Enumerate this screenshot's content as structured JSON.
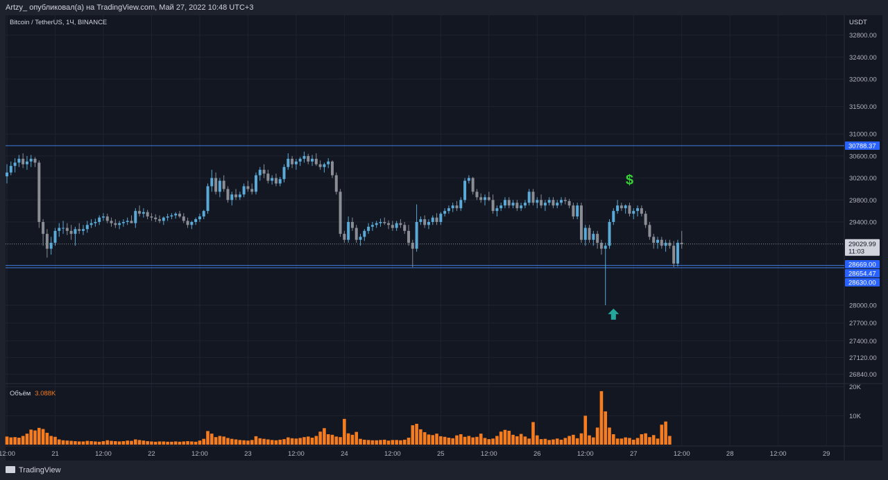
{
  "header": {
    "publish_text": "Artzy_ опубликовал(а) на TradingView.com, Май 27, 2022 10:48 UTC+3"
  },
  "chart_title": "Bitcoin / TetherUS, 1Ч, BINANCE",
  "footer": {
    "brand": "TradingView"
  },
  "colors": {
    "bg": "#131722",
    "up": "#5aa9d6",
    "down": "#8a8d94",
    "volume": "#f57c1f",
    "line": "#3f7fe0",
    "arrow": "#26a69a",
    "dollar": "#35d135"
  },
  "chart_data": {
    "type": "candlestick",
    "symbol": "BTCUSDT",
    "price_axis": {
      "currency": "USDT",
      "ticks": [
        32800,
        32400,
        32000,
        31500,
        31000,
        30600,
        30200,
        29800,
        29400,
        28000,
        27700,
        27400,
        27120,
        26840
      ],
      "tick_labels": [
        "32800.00",
        "32400.00",
        "32000.00",
        "31500.00",
        "31000.00",
        "30600.00",
        "30200.00",
        "29800.00",
        "29400.00",
        "28000.00",
        "27700.00",
        "27400.00",
        "27120.00",
        "26840.00"
      ]
    },
    "time_axis": {
      "ticks": [
        0,
        12,
        24,
        36,
        48,
        60,
        72,
        84,
        96,
        108,
        120,
        132,
        144,
        156,
        168,
        180,
        192,
        204
      ],
      "tick_labels": [
        "12:00",
        "21",
        "12:00",
        "22",
        "12:00",
        "23",
        "12:00",
        "24",
        "12:00",
        "25",
        "12:00",
        "26",
        "12:00",
        "27",
        "12:00",
        "28",
        "12:00",
        "29"
      ]
    },
    "horizontal_lines": [
      {
        "price": 30788.37,
        "label": "30788.37"
      },
      {
        "price": 28669.0,
        "label": "28669.00"
      },
      {
        "price": 28654.47,
        "label": "28654.47"
      },
      {
        "price": 28630.0,
        "label": "28630.00"
      }
    ],
    "last_price": {
      "value": 29029.99,
      "label": "29029.99",
      "countdown": "11:03"
    },
    "annotations": {
      "dollar_text": "$",
      "dollar_at": [
        155,
        30080
      ],
      "arrow_up_at": [
        151,
        27850
      ]
    },
    "candles": [
      [
        30230,
        30450,
        30100,
        30300
      ],
      [
        30300,
        30500,
        30250,
        30420
      ],
      [
        30420,
        30560,
        30300,
        30480
      ],
      [
        30480,
        30620,
        30400,
        30550
      ],
      [
        30550,
        30650,
        30380,
        30450
      ],
      [
        30450,
        30600,
        30350,
        30500
      ],
      [
        30500,
        30620,
        30400,
        30550
      ],
      [
        30550,
        30580,
        30400,
        30480
      ],
      [
        30480,
        30520,
        29300,
        29400
      ],
      [
        29400,
        29450,
        29000,
        29200
      ],
      [
        29200,
        29280,
        28800,
        28950
      ],
      [
        28950,
        29150,
        28850,
        29050
      ],
      [
        29050,
        29300,
        29000,
        29250
      ],
      [
        29250,
        29380,
        29150,
        29300
      ],
      [
        29300,
        29420,
        29200,
        29300
      ],
      [
        29300,
        29380,
        29180,
        29250
      ],
      [
        29250,
        29350,
        29100,
        29200
      ],
      [
        29200,
        29320,
        29000,
        29280
      ],
      [
        29280,
        29380,
        29200,
        29250
      ],
      [
        29250,
        29350,
        29180,
        29280
      ],
      [
        29280,
        29420,
        29220,
        29350
      ],
      [
        29350,
        29450,
        29300,
        29380
      ],
      [
        29380,
        29460,
        29320,
        29400
      ],
      [
        29400,
        29520,
        29350,
        29480
      ],
      [
        29480,
        29560,
        29420,
        29500
      ],
      [
        29500,
        29550,
        29380,
        29420
      ],
      [
        29420,
        29480,
        29320,
        29380
      ],
      [
        29380,
        29450,
        29300,
        29350
      ],
      [
        29350,
        29420,
        29280,
        29380
      ],
      [
        29380,
        29450,
        29320,
        29400
      ],
      [
        29400,
        29480,
        29350,
        29420
      ],
      [
        29420,
        29520,
        29380,
        29380
      ],
      [
        29380,
        29650,
        29300,
        29600
      ],
      [
        29600,
        29700,
        29500,
        29550
      ],
      [
        29550,
        29650,
        29480,
        29580
      ],
      [
        29580,
        29620,
        29450,
        29500
      ],
      [
        29500,
        29560,
        29420,
        29480
      ],
      [
        29480,
        29540,
        29400,
        29450
      ],
      [
        29450,
        29520,
        29380,
        29420
      ],
      [
        29420,
        29500,
        29350,
        29480
      ],
      [
        29480,
        29550,
        29420,
        29500
      ],
      [
        29500,
        29560,
        29450,
        29520
      ],
      [
        29520,
        29580,
        29460,
        29550
      ],
      [
        29550,
        29600,
        29470,
        29500
      ],
      [
        29500,
        29560,
        29380,
        29420
      ],
      [
        29420,
        29480,
        29300,
        29350
      ],
      [
        29350,
        29420,
        29280,
        29400
      ],
      [
        29400,
        29480,
        29350,
        29450
      ],
      [
        29450,
        29550,
        29400,
        29500
      ],
      [
        29500,
        29620,
        29450,
        29600
      ],
      [
        29600,
        30100,
        29550,
        30050
      ],
      [
        30050,
        30350,
        29950,
        30200
      ],
      [
        30200,
        30300,
        29900,
        29950
      ],
      [
        29950,
        30200,
        29850,
        30150
      ],
      [
        30150,
        30250,
        29950,
        30000
      ],
      [
        30000,
        30050,
        29750,
        29800
      ],
      [
        29800,
        29950,
        29700,
        29900
      ],
      [
        29900,
        30000,
        29800,
        29850
      ],
      [
        29850,
        29950,
        29800,
        29900
      ],
      [
        29900,
        30100,
        29850,
        30050
      ],
      [
        30050,
        30150,
        29950,
        30000
      ],
      [
        30000,
        30100,
        29900,
        29950
      ],
      [
        29950,
        30300,
        29900,
        30250
      ],
      [
        30250,
        30400,
        30150,
        30350
      ],
      [
        30350,
        30450,
        30200,
        30280
      ],
      [
        30280,
        30350,
        30100,
        30150
      ],
      [
        30150,
        30250,
        30080,
        30200
      ],
      [
        30200,
        30280,
        30050,
        30100
      ],
      [
        30100,
        30220,
        30050,
        30180
      ],
      [
        30180,
        30450,
        30120,
        30400
      ],
      [
        30400,
        30650,
        30350,
        30550
      ],
      [
        30550,
        30600,
        30380,
        30450
      ],
      [
        30450,
        30550,
        30350,
        30500
      ],
      [
        30500,
        30580,
        30420,
        30550
      ],
      [
        30550,
        30680,
        30480,
        30600
      ],
      [
        30600,
        30640,
        30450,
        30500
      ],
      [
        30500,
        30620,
        30420,
        30550
      ],
      [
        30550,
        30650,
        30420,
        30450
      ],
      [
        30450,
        30520,
        30350,
        30400
      ],
      [
        30400,
        30480,
        30300,
        30450
      ],
      [
        30450,
        30560,
        30380,
        30500
      ],
      [
        30500,
        30520,
        30200,
        30250
      ],
      [
        30250,
        30300,
        29900,
        29950
      ],
      [
        29950,
        30000,
        29150,
        29200
      ],
      [
        29200,
        29250,
        29050,
        29100
      ],
      [
        29100,
        29500,
        29050,
        29400
      ],
      [
        29400,
        29480,
        29250,
        29300
      ],
      [
        29300,
        29350,
        29050,
        29100
      ],
      [
        29100,
        29200,
        29000,
        29150
      ],
      [
        29150,
        29280,
        29080,
        29250
      ],
      [
        29250,
        29380,
        29200,
        29320
      ],
      [
        29320,
        29400,
        29250,
        29350
      ],
      [
        29350,
        29420,
        29300,
        29380
      ],
      [
        29380,
        29460,
        29320,
        29400
      ],
      [
        29400,
        29480,
        29350,
        29380
      ],
      [
        29380,
        29430,
        29280,
        29350
      ],
      [
        29350,
        29420,
        29250,
        29300
      ],
      [
        29300,
        29420,
        29250,
        29380
      ],
      [
        29380,
        29450,
        29300,
        29350
      ],
      [
        29350,
        29400,
        29200,
        29250
      ],
      [
        29250,
        29350,
        29000,
        29050
      ],
      [
        29050,
        29100,
        28640,
        28950
      ],
      [
        28950,
        29720,
        28900,
        29400
      ],
      [
        29400,
        29500,
        29350,
        29450
      ],
      [
        29450,
        29520,
        29300,
        29350
      ],
      [
        29350,
        29450,
        29280,
        29400
      ],
      [
        29400,
        29520,
        29350,
        29480
      ],
      [
        29480,
        29560,
        29350,
        29400
      ],
      [
        29400,
        29580,
        29350,
        29550
      ],
      [
        29550,
        29650,
        29500,
        29600
      ],
      [
        29600,
        29700,
        29550,
        29650
      ],
      [
        29650,
        29750,
        29580,
        29700
      ],
      [
        29700,
        29780,
        29600,
        29650
      ],
      [
        29650,
        29850,
        29600,
        29800
      ],
      [
        29800,
        30200,
        29750,
        30150
      ],
      [
        30150,
        30250,
        30100,
        30200
      ],
      [
        30200,
        30220,
        29900,
        29950
      ],
      [
        29950,
        30000,
        29800,
        29850
      ],
      [
        29850,
        29920,
        29750,
        29800
      ],
      [
        29800,
        29900,
        29700,
        29850
      ],
      [
        29850,
        29950,
        29780,
        29800
      ],
      [
        29800,
        29900,
        29550,
        29600
      ],
      [
        29600,
        29700,
        29500,
        29650
      ],
      [
        29650,
        29750,
        29600,
        29700
      ],
      [
        29700,
        29850,
        29650,
        29800
      ],
      [
        29800,
        29850,
        29650,
        29700
      ],
      [
        29700,
        29800,
        29650,
        29750
      ],
      [
        29750,
        29800,
        29600,
        29650
      ],
      [
        29650,
        29750,
        29600,
        29700
      ],
      [
        29700,
        29800,
        29650,
        29750
      ],
      [
        29750,
        30000,
        29700,
        29950
      ],
      [
        29950,
        30000,
        29700,
        29750
      ],
      [
        29750,
        29850,
        29650,
        29800
      ],
      [
        29800,
        29900,
        29650,
        29700
      ],
      [
        29700,
        29800,
        29600,
        29750
      ],
      [
        29750,
        29850,
        29700,
        29800
      ],
      [
        29800,
        29850,
        29650,
        29700
      ],
      [
        29700,
        29800,
        29650,
        29750
      ],
      [
        29750,
        29850,
        29700,
        29800
      ],
      [
        29800,
        29850,
        29720,
        29780
      ],
      [
        29780,
        29820,
        29650,
        29700
      ],
      [
        29700,
        29750,
        29450,
        29500
      ],
      [
        29500,
        29750,
        29450,
        29700
      ],
      [
        29700,
        29750,
        29050,
        29100
      ],
      [
        29100,
        29350,
        29000,
        29300
      ],
      [
        29300,
        29350,
        29050,
        29100
      ],
      [
        29100,
        29250,
        29000,
        29200
      ],
      [
        29200,
        29250,
        28950,
        29050
      ],
      [
        29050,
        29100,
        28850,
        28950
      ],
      [
        28950,
        29050,
        28000,
        29000
      ],
      [
        29000,
        29450,
        28950,
        29400
      ],
      [
        29400,
        29650,
        29350,
        29600
      ],
      [
        29600,
        29800,
        29550,
        29700
      ],
      [
        29700,
        29750,
        29600,
        29650
      ],
      [
        29650,
        29720,
        29550,
        29700
      ],
      [
        29700,
        29750,
        29500,
        29550
      ],
      [
        29550,
        29650,
        29450,
        29600
      ],
      [
        29600,
        29700,
        29500,
        29650
      ],
      [
        29650,
        29700,
        29500,
        29550
      ],
      [
        29550,
        29600,
        29300,
        29350
      ],
      [
        29350,
        29400,
        29100,
        29150
      ],
      [
        29150,
        29200,
        28950,
        29050
      ],
      [
        29050,
        29150,
        28950,
        29100
      ],
      [
        29100,
        29150,
        28950,
        29000
      ],
      [
        29000,
        29100,
        28900,
        29050
      ],
      [
        29050,
        29100,
        28950,
        29000
      ],
      [
        29000,
        29080,
        28640,
        28700
      ],
      [
        28700,
        29100,
        28650,
        29050
      ],
      [
        29050,
        29250,
        28950,
        29030
      ]
    ],
    "volume": {
      "label": "Объём",
      "value_label": "3.088K",
      "axis_ticks": [
        20000,
        10000
      ],
      "axis_tick_labels": [
        "20K",
        "10K"
      ],
      "values": [
        2800,
        2500,
        2600,
        2400,
        3000,
        3800,
        5200,
        4900,
        5800,
        5400,
        4100,
        3000,
        2700,
        1800,
        1500,
        1400,
        1300,
        1200,
        1100,
        1100,
        1300,
        1200,
        1100,
        1000,
        1200,
        1500,
        1300,
        1200,
        1100,
        1200,
        1400,
        1300,
        1800,
        1600,
        1400,
        1200,
        1100,
        1000,
        1100,
        1100,
        1000,
        1000,
        1100,
        1000,
        1100,
        1200,
        1100,
        1000,
        1400,
        2000,
        4700,
        3800,
        2600,
        3000,
        2800,
        2300,
        2000,
        1800,
        1600,
        1500,
        1400,
        1600,
        2900,
        2200,
        2000,
        1800,
        1600,
        1500,
        1700,
        1900,
        2500,
        2200,
        2100,
        2300,
        2600,
        2800,
        2400,
        3000,
        4500,
        5700,
        3600,
        3400,
        2800,
        2600,
        8900,
        3900,
        3400,
        4400,
        2000,
        1700,
        1600,
        1500,
        1500,
        1600,
        1700,
        1400,
        1600,
        1600,
        1500,
        1700,
        2400,
        6700,
        7200,
        5300,
        4300,
        3500,
        3300,
        3800,
        2900,
        2700,
        2400,
        2200,
        3200,
        3600,
        2700,
        3000,
        2500,
        2700,
        3800,
        2300,
        1900,
        2100,
        3000,
        4500,
        5100,
        4800,
        3400,
        2900,
        3700,
        2800,
        2100,
        7800,
        3200,
        1900,
        2000,
        1600,
        1800,
        2100,
        1700,
        2300,
        3000,
        3400,
        2200,
        3900,
        10000,
        3200,
        2500,
        5900,
        18500,
        11500,
        5900,
        3600,
        2100,
        2100,
        2500,
        2300,
        1700,
        2300,
        3600,
        3900,
        2600,
        3300,
        2100,
        6900,
        8000,
        3000
      ]
    }
  }
}
